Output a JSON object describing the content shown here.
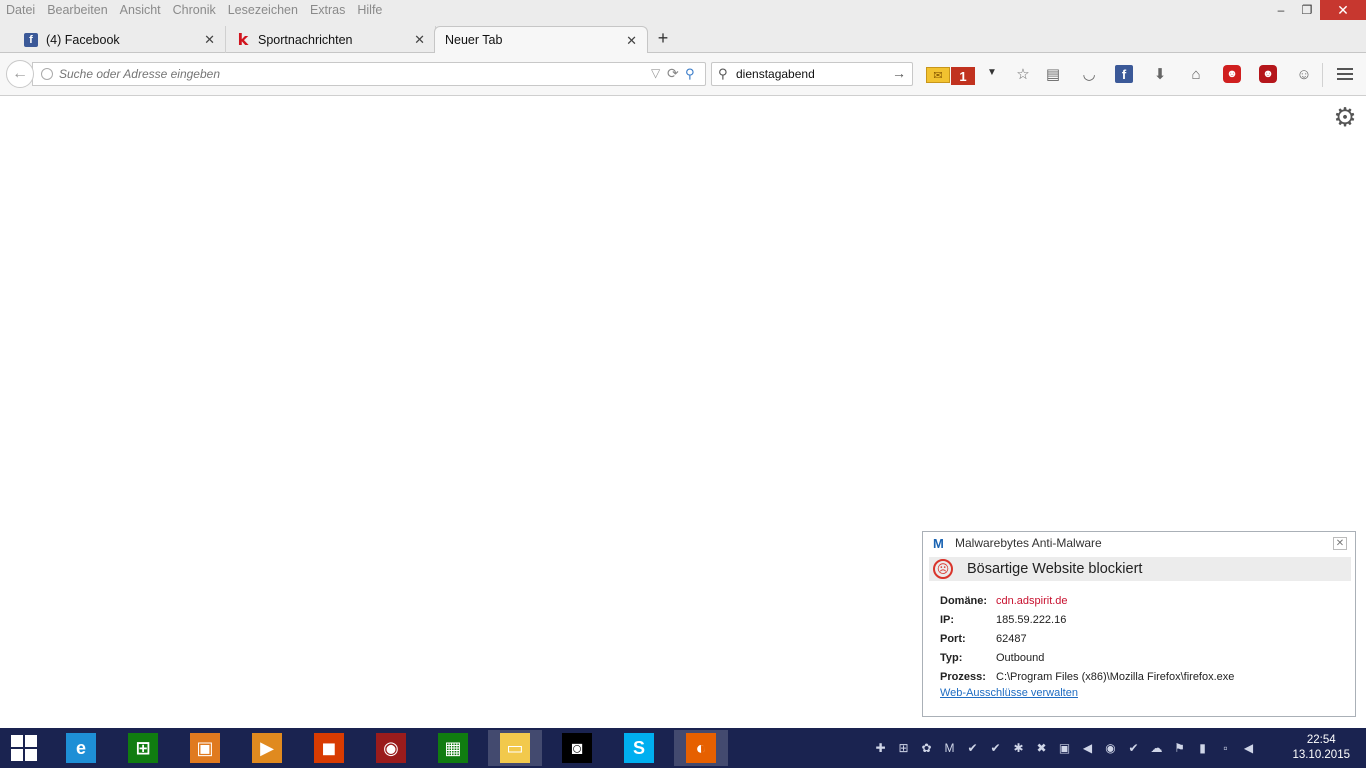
{
  "menubar": {
    "items": [
      "Datei",
      "Bearbeiten",
      "Ansicht",
      "Chronik",
      "Lesezeichen",
      "Extras",
      "Hilfe"
    ],
    "minimize": "‒",
    "restore": "❐",
    "close": "✕"
  },
  "tabs": [
    {
      "label": "(4) Facebook",
      "icon": "f"
    },
    {
      "label": "Sportnachrichten",
      "icon": "k"
    },
    {
      "label": "Neuer Tab"
    }
  ],
  "tab_close": "✕",
  "new_tab": "+",
  "navbar": {
    "back": "←",
    "url_placeholder": "Suche oder Adresse eingeben",
    "url_dropdown": "▽",
    "reload": "⟳",
    "go": "⚲",
    "search_icon": "⚲",
    "search_value": "dienstagabend",
    "search_go": "→",
    "mail_icon": "✉",
    "mail_count": "1",
    "mail_dropdown": "▼",
    "bookmark_star": "☆",
    "reading_list": "▤",
    "pocket": "◡",
    "facebook": "f",
    "download": "⬇",
    "home": "⌂",
    "addon_red": "☻",
    "addon_red2": "☻",
    "chat": "☺"
  },
  "content": {
    "settings_icon": "⚙"
  },
  "malwarebytes": {
    "app_name": "Malwarebytes Anti-Malware",
    "close": "✕",
    "alert_title": "Bösartige Website blockiert",
    "rows": [
      {
        "label": "Domäne:",
        "value": "cdn.adspirit.de"
      },
      {
        "label": "IP:",
        "value": "185.59.222.16"
      },
      {
        "label": "Port:",
        "value": "62487"
      },
      {
        "label": "Typ:",
        "value": "Outbound"
      },
      {
        "label": "Prozess:",
        "value": "C:\\Program Files (x86)\\Mozilla Firefox\\firefox.exe"
      }
    ],
    "link": "Web-Ausschlüsse verwalten",
    "domain_color": "#c8102e"
  },
  "taskbar": {
    "apps": [
      {
        "name": "internet-explorer",
        "glyph": "e",
        "color": "#1e8fd6"
      },
      {
        "name": "store",
        "glyph": "⊞",
        "color": "#107c10"
      },
      {
        "name": "photo-app",
        "glyph": "▣",
        "color": "#e07a1f"
      },
      {
        "name": "media-player",
        "glyph": "▶",
        "color": "#e08a1f"
      },
      {
        "name": "office",
        "glyph": "◼",
        "color": "#d83b01"
      },
      {
        "name": "audio-app",
        "glyph": "◉",
        "color": "#9b1c1c"
      },
      {
        "name": "calculator",
        "glyph": "▦",
        "color": "#107c10"
      },
      {
        "name": "file-explorer",
        "glyph": "▭",
        "color": "#f2c94c"
      },
      {
        "name": "camera",
        "glyph": "◙",
        "color": "#000000"
      },
      {
        "name": "skype",
        "glyph": "S",
        "color": "#00aff0"
      },
      {
        "name": "firefox",
        "glyph": "◐",
        "color": "#e66000"
      }
    ],
    "tray_icons": [
      "✚",
      "⊞",
      "✿",
      "M",
      "✔",
      "✔",
      "✱",
      "✖",
      "▣",
      "◀",
      "◉",
      "✔",
      "☁",
      "⚑",
      "▮",
      "▫",
      "◀"
    ],
    "time": "22:54",
    "date": "13.10.2015"
  }
}
